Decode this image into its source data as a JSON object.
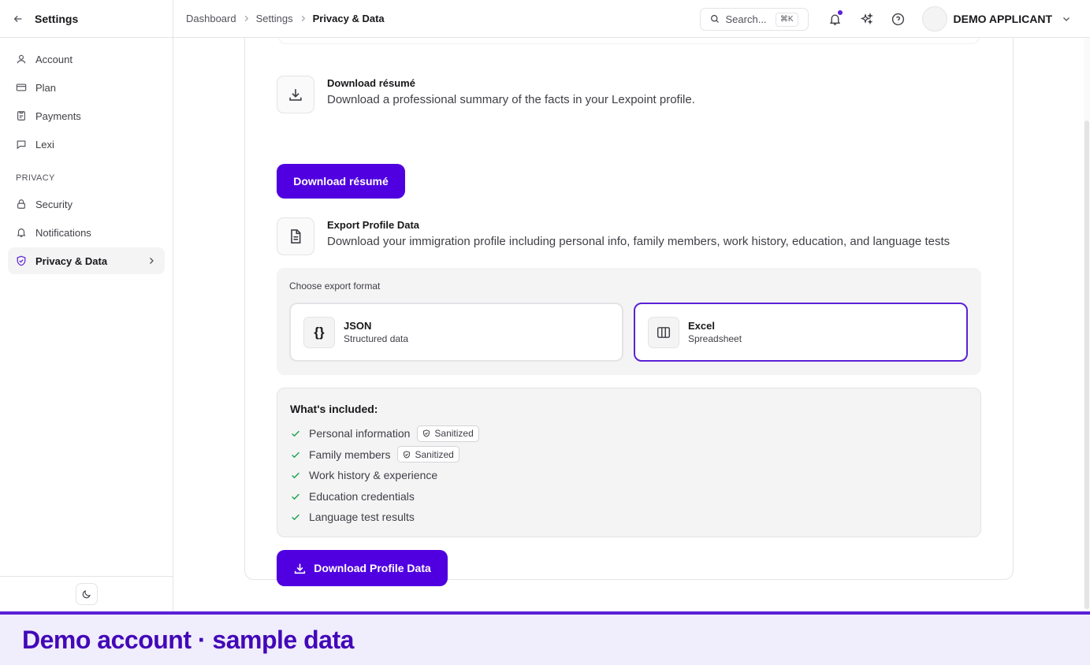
{
  "sidebar": {
    "title": "Settings",
    "items": [
      {
        "label": "Account"
      },
      {
        "label": "Plan"
      },
      {
        "label": "Payments"
      },
      {
        "label": "Lexi"
      }
    ],
    "section_label": "PRIVACY",
    "privacy_items": [
      {
        "label": "Security"
      },
      {
        "label": "Notifications"
      },
      {
        "label": "Privacy & Data"
      }
    ]
  },
  "breadcrumb": [
    "Dashboard",
    "Settings",
    "Privacy & Data"
  ],
  "search": {
    "placeholder": "Search...",
    "shortcut": "⌘K"
  },
  "user": {
    "name": "DEMO APPLICANT"
  },
  "resume": {
    "title": "Download résumé",
    "description": "Download a professional summary of the facts in your Lexpoint profile.",
    "button": "Download résumé"
  },
  "export": {
    "title": "Export Profile Data",
    "description": "Download your immigration profile including personal info, family members, work history, education, and language tests",
    "format_label": "Choose export format",
    "formats": [
      {
        "icon_text": "{}",
        "title": "JSON",
        "subtitle": "Structured data",
        "selected": false
      },
      {
        "title": "Excel",
        "subtitle": "Spreadsheet",
        "selected": true
      }
    ],
    "included_title": "What's included:",
    "included": [
      {
        "label": "Personal information",
        "badge": "Sanitized"
      },
      {
        "label": "Family members",
        "badge": "Sanitized"
      },
      {
        "label": "Work history & experience"
      },
      {
        "label": "Education credentials"
      },
      {
        "label": "Language test results"
      }
    ],
    "button": "Download Profile Data"
  },
  "banner": "Demo account · sample data",
  "colors": {
    "accent": "#5000e0",
    "selected_border": "#5b21d6",
    "check": "#16a34a",
    "banner_text": "#4208b8"
  }
}
